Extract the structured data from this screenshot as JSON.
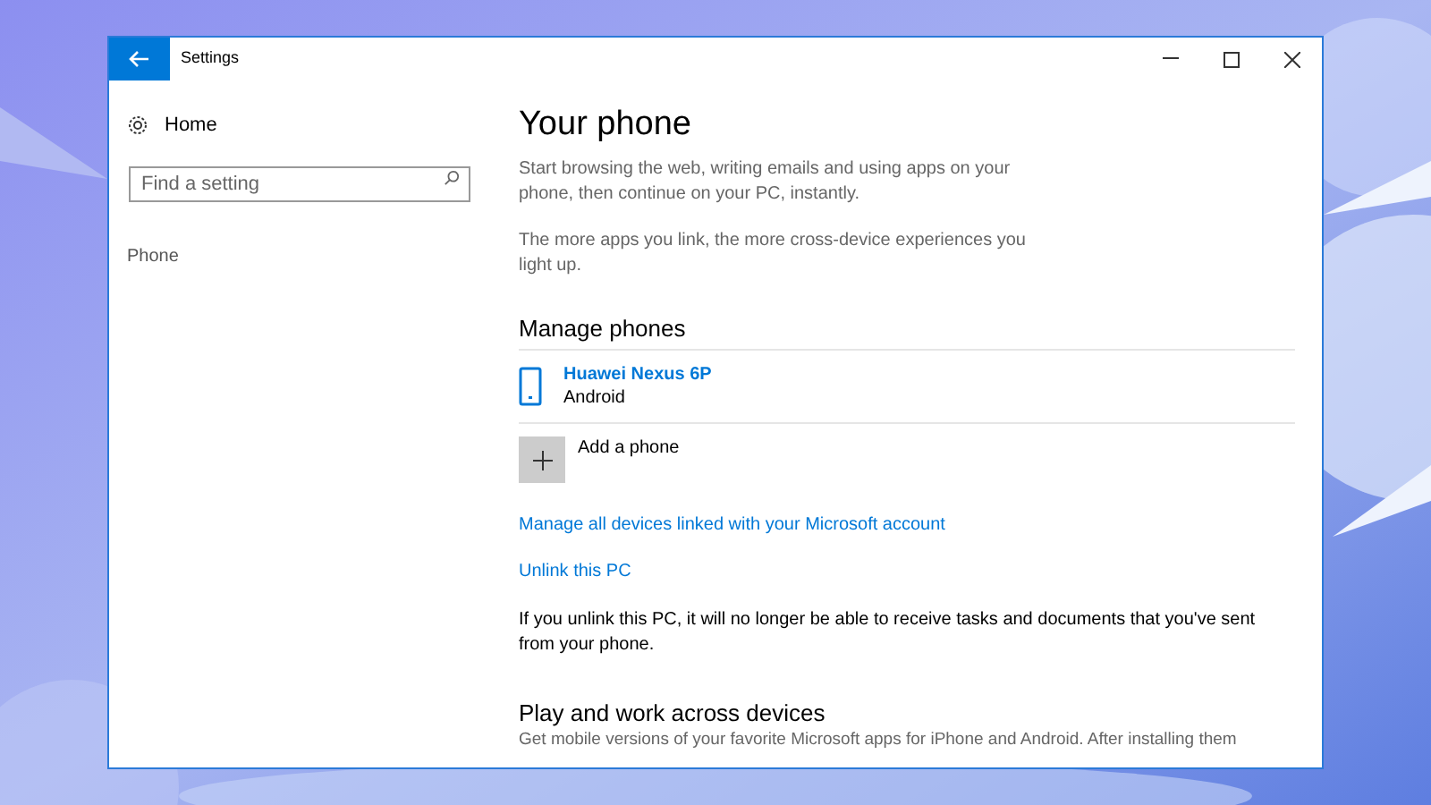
{
  "window": {
    "title": "Settings"
  },
  "sidebar": {
    "home": "Home",
    "search": {
      "placeholder": "Find a setting"
    },
    "items": [
      {
        "label": "Phone",
        "selected": false
      }
    ]
  },
  "content": {
    "title": "Your phone",
    "paragraphs": [
      "Start browsing the web, writing emails and using apps on your phone, then continue on your PC, instantly.",
      "The more apps you link, the more cross-device experiences you light up."
    ],
    "manage_phones": {
      "heading": "Manage phones",
      "phones": [
        {
          "name": "Huawei Nexus 6P",
          "os": "Android"
        }
      ],
      "add": "Add a phone"
    },
    "links": [
      "Manage all devices linked with your Microsoft account",
      "Unlink this PC"
    ],
    "note": "If you unlink this PC, it will no longer be able to receive tasks and documents that you've sent from your phone.",
    "section2": {
      "heading": "Play and work across devices",
      "text": "Get mobile versions of your favorite Microsoft apps for iPhone and Android. After installing them"
    }
  }
}
